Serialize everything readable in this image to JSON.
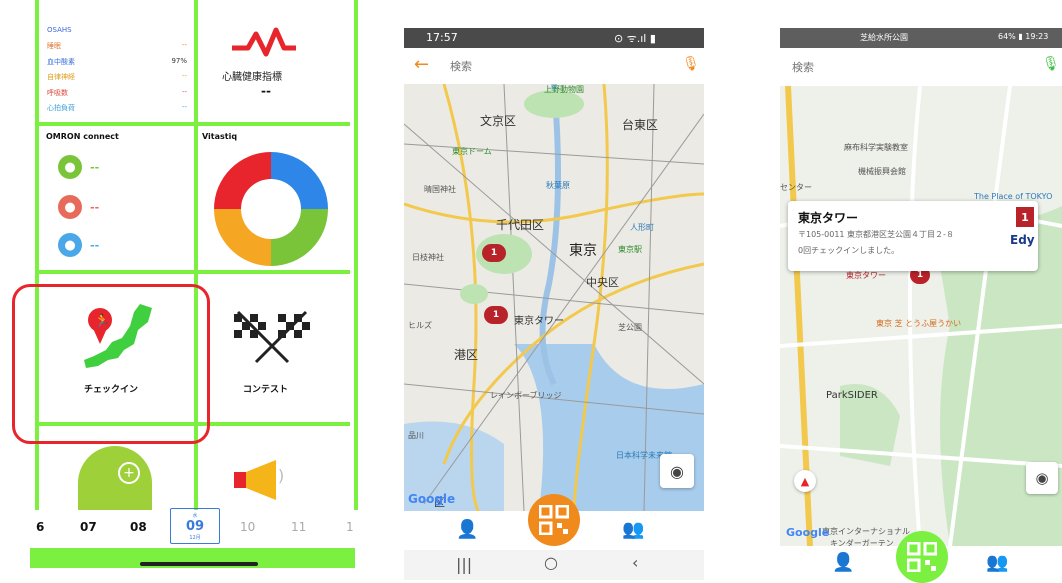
{
  "screen1": {
    "metrics": [
      {
        "label": "OSAHS",
        "value": "",
        "color": "#3a6ad8"
      },
      {
        "label": "睡眠",
        "value": "--",
        "color": "#e27a3a"
      },
      {
        "label": "血中酸素",
        "value": "97%",
        "color": "#3a6ad8"
      },
      {
        "label": "自律神経",
        "value": "--",
        "color": "#e0a020"
      },
      {
        "label": "呼吸数",
        "value": "--",
        "color": "#e2463a"
      },
      {
        "label": "心拍負荷",
        "value": "--",
        "color": "#3aa0d8"
      }
    ],
    "heart_title": "心臓健康指標",
    "heart_value": "--",
    "omron_title": "OMRON connect",
    "omron_values": [
      "--",
      "--",
      "--"
    ],
    "vitastiq_title": "Vitastiq",
    "checkin_label": "チェックイン",
    "contest_label": "コンテスト",
    "dates": [
      "6",
      "07",
      "08",
      "09",
      "10",
      "11",
      "1"
    ],
    "selected_date_top": "水",
    "selected_date": "09",
    "selected_date_month": "12月",
    "donut": [
      {
        "color": "#2e86e8",
        "fraction": 0.25
      },
      {
        "color": "#7ac43a",
        "fraction": 0.25
      },
      {
        "color": "#f5a623",
        "fraction": 0.25
      },
      {
        "color": "#e8242c",
        "fraction": 0.25
      }
    ],
    "accent": "#7cf040"
  },
  "screen2": {
    "status_time": "17:57",
    "status_right": "⊙ ᯤ.ıl ▮",
    "search_placeholder": "検索",
    "map_labels": [
      "文京区",
      "台東区",
      "上野動物園",
      "東京ドーム",
      "秋葉原",
      "晴国神社",
      "千代田区",
      "東京",
      "人形町",
      "東京駅",
      "日枝神社",
      "中央区",
      "東京タワー",
      "港区",
      "芝公園",
      "ヒルズ",
      "品川",
      "レインボーブリッジ",
      "日本科学未来館",
      "区"
    ],
    "pin_count_1": "1",
    "pin_count_2": "1",
    "google": "Google",
    "nav_sys": [
      "|||",
      "○",
      "‹"
    ],
    "orange": "#f08a1c"
  },
  "screen3": {
    "status_left": "芝給水所公園",
    "status_right": "64% ▮ 19:23",
    "search_placeholder": "検索",
    "card_title": "東京タワー",
    "card_address": "〒105-0011 東京都港区芝公園４丁目２-８",
    "card_checkins": "0回チェックインしました。",
    "card_badge": "1",
    "card_edy": "Edy",
    "map_labels": [
      "麻布科学実験教室",
      "機械振興会館",
      "The Place of TOKYO",
      "東京タワー",
      "東京 芝 とうふ屋うかい",
      "ParkSIDER",
      "東京インターナショナル",
      "キンダーガーテン",
      "センター"
    ],
    "pin_count": "1",
    "google": "Google",
    "green": "#7cf040"
  }
}
